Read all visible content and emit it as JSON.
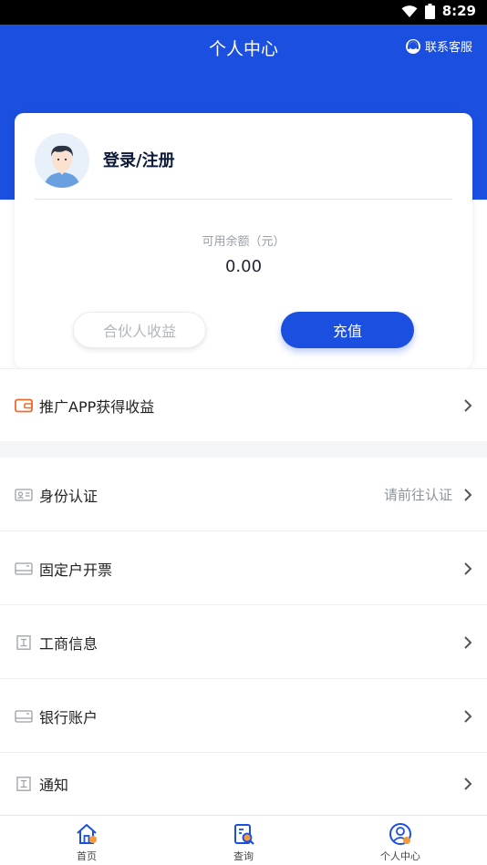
{
  "status_bar": {
    "time": "8:29"
  },
  "header": {
    "title": "个人中心",
    "customer_service": "联系客服"
  },
  "account": {
    "login_label": "登录/注册",
    "balance_label": "可用余额（元）",
    "balance_value": "0.00",
    "partner_button": "合伙人收益",
    "recharge_button": "充值"
  },
  "promo": {
    "label": "推广APP获得收益"
  },
  "menu": [
    {
      "label": "身份认证",
      "value": "请前往认证",
      "icon": "id-card-icon"
    },
    {
      "label": "固定户开票",
      "value": "",
      "icon": "invoice-icon"
    },
    {
      "label": "工商信息",
      "value": "",
      "icon": "business-info-icon"
    },
    {
      "label": "银行账户",
      "value": "",
      "icon": "bank-card-icon"
    },
    {
      "label": "通知",
      "value": "",
      "icon": "notice-icon"
    }
  ],
  "tabbar": [
    {
      "label": "首页",
      "icon": "home-icon"
    },
    {
      "label": "查询",
      "icon": "query-icon"
    },
    {
      "label": "个人中心",
      "icon": "profile-icon",
      "active": true
    }
  ],
  "colors": {
    "primary": "#1a4fe0",
    "accent": "#f39a3a",
    "promo_icon": "#f06a2a"
  }
}
